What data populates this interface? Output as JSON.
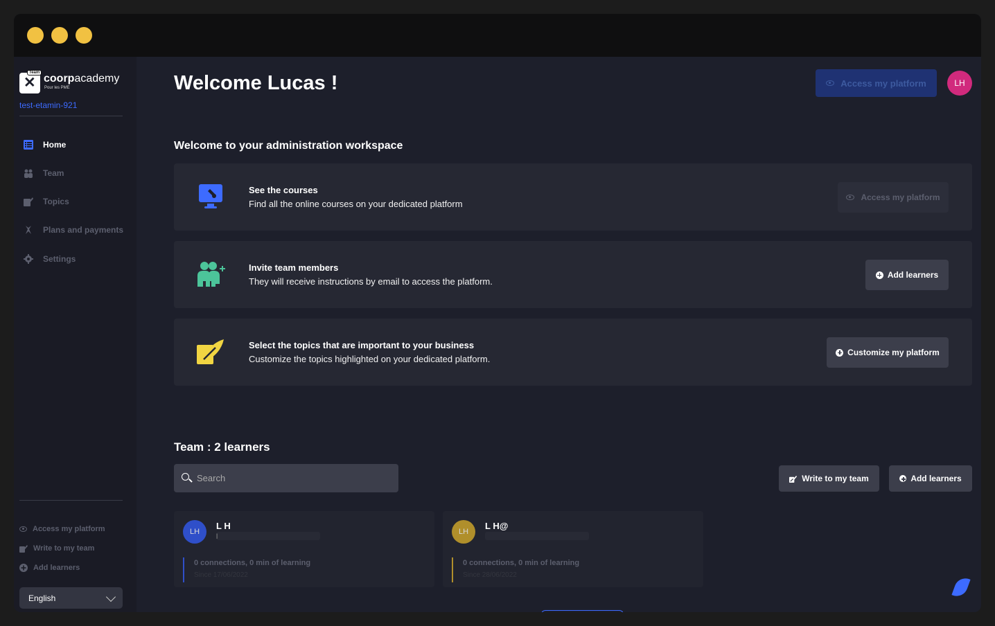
{
  "sidebar": {
    "brand_prefix": "coorp",
    "brand_suffix": "academy",
    "brand_sub": "Pour les PME",
    "brand_tag": "Team",
    "org": "test-etamin-921",
    "nav": [
      {
        "label": "Home",
        "icon": "home-list-icon"
      },
      {
        "label": "Team",
        "icon": "team-icon"
      },
      {
        "label": "Topics",
        "icon": "topics-edit-icon"
      },
      {
        "label": "Plans and payments",
        "icon": "plans-icon"
      },
      {
        "label": "Settings",
        "icon": "gear-icon"
      }
    ],
    "bottom_links": [
      {
        "label": "Access my platform",
        "icon": "eye-icon"
      },
      {
        "label": "Write to my team",
        "icon": "edit-icon"
      },
      {
        "label": "Add learners",
        "icon": "plus-circle-icon"
      }
    ],
    "language": "English"
  },
  "header": {
    "title": "Welcome Lucas !",
    "access_button": "Access my platform",
    "avatar": "LH"
  },
  "workspace": {
    "title": "Welcome to your administration workspace",
    "cards": [
      {
        "title": "See the courses",
        "desc": "Find all the online courses on your dedicated platform",
        "button": "Access my platform",
        "icon": "monitor-course-icon"
      },
      {
        "title": "Invite team members",
        "desc": "They will receive instructions by email to access the platform.",
        "button": "Add learners",
        "icon": "people-add-icon"
      },
      {
        "title": "Select the topics that are important to your business",
        "desc": "Customize the topics highlighted on your dedicated platform.",
        "button": "Customize my platform",
        "icon": "topics-edit-icon"
      }
    ]
  },
  "team": {
    "title": "Team : 2 learners",
    "search_placeholder": "Search",
    "write_button": "Write to my team",
    "add_button": "Add learners",
    "learners": [
      {
        "initials": "LH",
        "name": "L H",
        "line": "l",
        "stats": "0 connections, 0 min of learning",
        "since": "Since 17/06/2022",
        "color": "#2f4fc9"
      },
      {
        "initials": "LH",
        "name": "L H@",
        "line": "",
        "stats": "0 connections, 0 min of learning",
        "since": "Since 28/06/2022",
        "color": "#b08f2b"
      }
    ]
  },
  "colors": {
    "accent": "#3d6bff",
    "avatar": "#d12a7d",
    "traffic_light": "#f1c142"
  }
}
